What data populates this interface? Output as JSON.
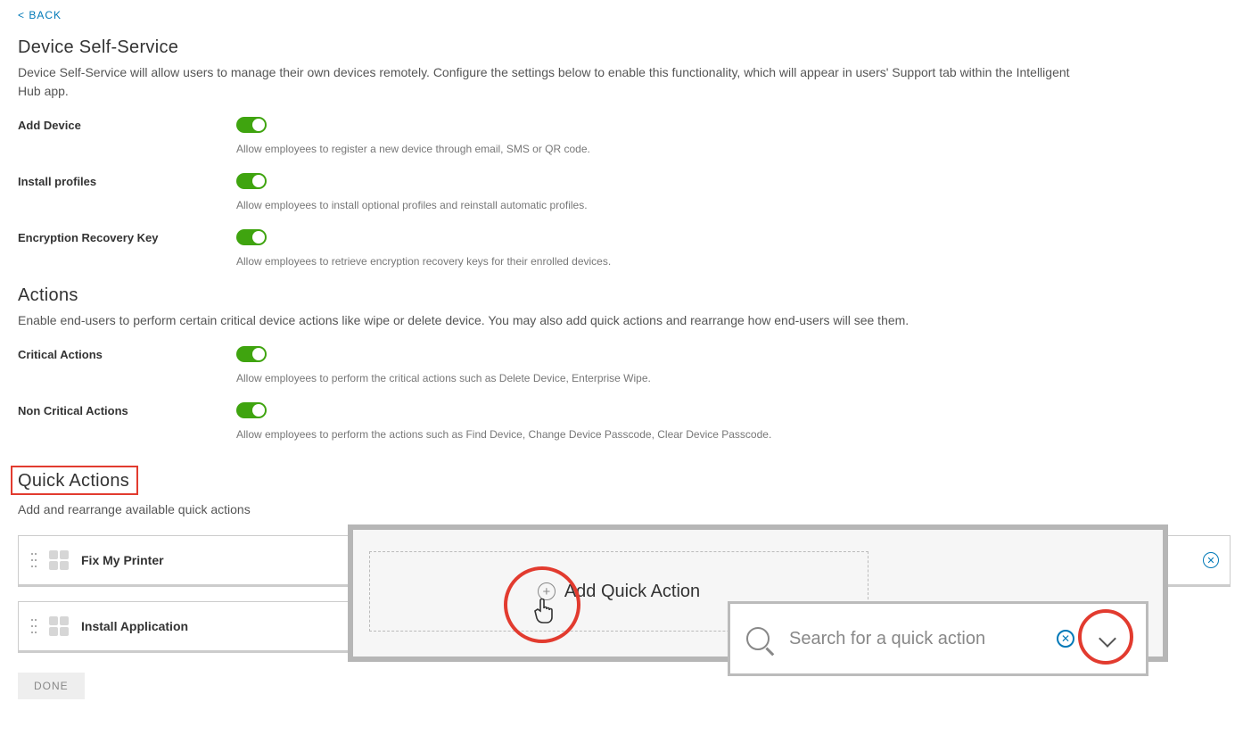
{
  "nav": {
    "back": "< BACK"
  },
  "deviceSelfService": {
    "title": "Device Self-Service",
    "desc": "Device Self-Service will allow users to manage their own devices remotely. Configure the settings below to enable this functionality, which will appear in users' Support tab within the Intelligent Hub app.",
    "settings": {
      "addDevice": {
        "label": "Add Device",
        "help": "Allow employees to register a new device through email, SMS or QR code."
      },
      "installProfiles": {
        "label": "Install profiles",
        "help": "Allow employees to install optional profiles and reinstall automatic profiles."
      },
      "encryptionKey": {
        "label": "Encryption Recovery Key",
        "help": "Allow employees to retrieve encryption recovery keys for their enrolled devices."
      }
    }
  },
  "actions": {
    "title": "Actions",
    "desc": "Enable end-users to perform certain critical device actions like wipe or delete device. You may also add quick actions and rearrange how end-users will see them.",
    "critical": {
      "label": "Critical Actions",
      "help": "Allow employees to perform the critical actions such as Delete Device, Enterprise Wipe."
    },
    "noncritical": {
      "label": "Non Critical Actions",
      "help": "Allow employees to perform the actions such as Find Device, Change Device Passcode, Clear Device Passcode."
    }
  },
  "quickActions": {
    "title": "Quick Actions",
    "desc": "Add and rearrange available quick actions",
    "items": [
      "Fix My Printer",
      "",
      "",
      "Install Application"
    ],
    "overlay": {
      "addLabel": "Add Quick Action",
      "searchPlaceholder": "Search for a quick action"
    }
  },
  "buttons": {
    "done": "DONE"
  }
}
